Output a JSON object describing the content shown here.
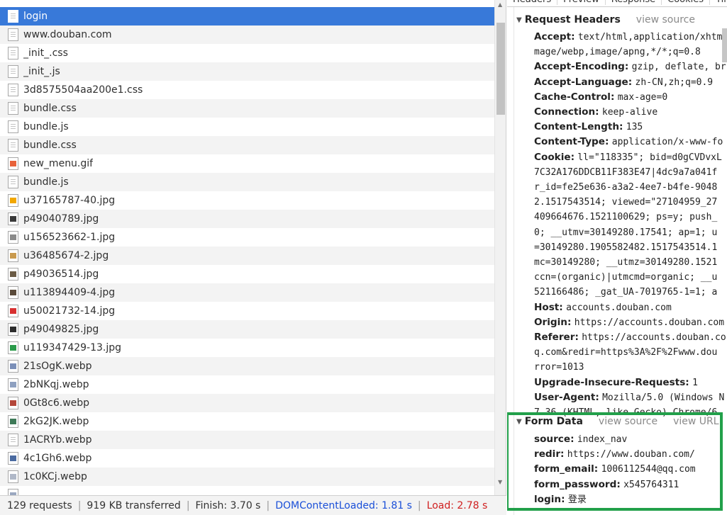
{
  "requests": [
    {
      "name": "login",
      "icon": "doc",
      "selected": true
    },
    {
      "name": "www.douban.com",
      "icon": "doc"
    },
    {
      "name": "_init_.css",
      "icon": "doc"
    },
    {
      "name": "_init_.js",
      "icon": "doc"
    },
    {
      "name": "3d8575504aa200e1.css",
      "icon": "doc"
    },
    {
      "name": "bundle.css",
      "icon": "doc"
    },
    {
      "name": "bundle.js",
      "icon": "doc"
    },
    {
      "name": "bundle.css",
      "icon": "doc"
    },
    {
      "name": "new_menu.gif",
      "icon": "img",
      "color": "#e8623a"
    },
    {
      "name": "bundle.js",
      "icon": "doc"
    },
    {
      "name": "u37165787-40.jpg",
      "icon": "img",
      "color": "#f2a700"
    },
    {
      "name": "p49040789.jpg",
      "icon": "img",
      "color": "#3a3a3a"
    },
    {
      "name": "u156523662-1.jpg",
      "icon": "img",
      "color": "#8a8a8a"
    },
    {
      "name": "u36485674-2.jpg",
      "icon": "img",
      "color": "#c99a4e"
    },
    {
      "name": "p49036514.jpg",
      "icon": "img",
      "color": "#6b5b45"
    },
    {
      "name": "u113894409-4.jpg",
      "icon": "img",
      "color": "#5a4a3a"
    },
    {
      "name": "u50021732-14.jpg",
      "icon": "img",
      "color": "#d83030"
    },
    {
      "name": "p49049825.jpg",
      "icon": "img",
      "color": "#2e2e2e"
    },
    {
      "name": "u119347429-13.jpg",
      "icon": "img",
      "color": "#2a9a4a"
    },
    {
      "name": "21sOgK.webp",
      "icon": "img",
      "color": "#7a8fb8"
    },
    {
      "name": "2bNKqj.webp",
      "icon": "img",
      "color": "#8ea0c0"
    },
    {
      "name": "0Gt8c6.webp",
      "icon": "img",
      "color": "#b4473a"
    },
    {
      "name": "2kG2JK.webp",
      "icon": "img",
      "color": "#3e7a58"
    },
    {
      "name": "1ACRYb.webp",
      "icon": "doc"
    },
    {
      "name": "4c1Gh6.webp",
      "icon": "img",
      "color": "#4a6aa0"
    },
    {
      "name": "1c0KCj.webp",
      "icon": "img",
      "color": "#b0b8c8"
    },
    {
      "name": "",
      "icon": "img",
      "color": "#9aa8c0"
    }
  ],
  "status": {
    "requests": "129 requests",
    "transferred": "919 KB transferred",
    "finish": "Finish: 3.70 s",
    "dom_content_loaded": "DOMContentLoaded: 1.81 s",
    "load": "Load: 2.78 s",
    "dcl_color": "#1a4fd8",
    "load_color": "#d02020"
  },
  "tabs": [
    "Headers",
    "Preview",
    "Response",
    "Cookies",
    "Timing"
  ],
  "request_headers": {
    "title": "Request Headers",
    "view_source": "view source",
    "lines": [
      {
        "key": "Accept:",
        "value": "text/html,application/xhtm"
      },
      {
        "key": "",
        "value": "mage/webp,image/apng,*/*;q=0.8"
      },
      {
        "key": "Accept-Encoding:",
        "value": "gzip, deflate, br"
      },
      {
        "key": "Accept-Language:",
        "value": "zh-CN,zh;q=0.9"
      },
      {
        "key": "Cache-Control:",
        "value": "max-age=0"
      },
      {
        "key": "Connection:",
        "value": "keep-alive"
      },
      {
        "key": "Content-Length:",
        "value": "135"
      },
      {
        "key": "Content-Type:",
        "value": "application/x-www-fo"
      },
      {
        "key": "Cookie:",
        "value": "ll=\"118335\"; bid=d0gCVDvxL"
      },
      {
        "key": "",
        "value": "7C32A176DDCB11F383E47|4dc9a7a041f"
      },
      {
        "key": "",
        "value": "r_id=fe25e636-a3a2-4ee7-b4fe-9048"
      },
      {
        "key": "",
        "value": "2.1517543514; viewed=\"27104959_27"
      },
      {
        "key": "",
        "value": "409664676.1521100629; ps=y; push_"
      },
      {
        "key": "",
        "value": "0; __utmv=30149280.17541; ap=1; u"
      },
      {
        "key": "",
        "value": "=30149280.1905582482.1517543514.1"
      },
      {
        "key": "",
        "value": "mc=30149280; __utmz=30149280.1521"
      },
      {
        "key": "",
        "value": "ccn=(organic)|utmcmd=organic; __u"
      },
      {
        "key": "",
        "value": "521166486; _gat_UA-7019765-1=1; a"
      },
      {
        "key": "Host:",
        "value": "accounts.douban.com"
      },
      {
        "key": "Origin:",
        "value": "https://accounts.douban.com"
      },
      {
        "key": "Referer:",
        "value": "https://accounts.douban.co"
      },
      {
        "key": "",
        "value": "q.com&redir=https%3A%2F%2Fwww.dou"
      },
      {
        "key": "",
        "value": "rror=1013"
      },
      {
        "key": "Upgrade-Insecure-Requests:",
        "value": "1"
      },
      {
        "key": "User-Agent:",
        "value": "Mozilla/5.0 (Windows N"
      },
      {
        "key": "",
        "value": "7.36 (KHTML, like Gecko) Chrome/6"
      }
    ]
  },
  "form_data": {
    "title": "Form Data",
    "view_source": "view source",
    "view_url": "view URL",
    "highlight_color": "#22a04a",
    "lines": [
      {
        "key": "source:",
        "value": "index_nav"
      },
      {
        "key": "redir:",
        "value": "https://www.douban.com/"
      },
      {
        "key": "form_email:",
        "value": "1006112544@qq.com"
      },
      {
        "key": "form_password:",
        "value": "x545764311"
      },
      {
        "key": "login:",
        "value": "登录"
      }
    ]
  }
}
